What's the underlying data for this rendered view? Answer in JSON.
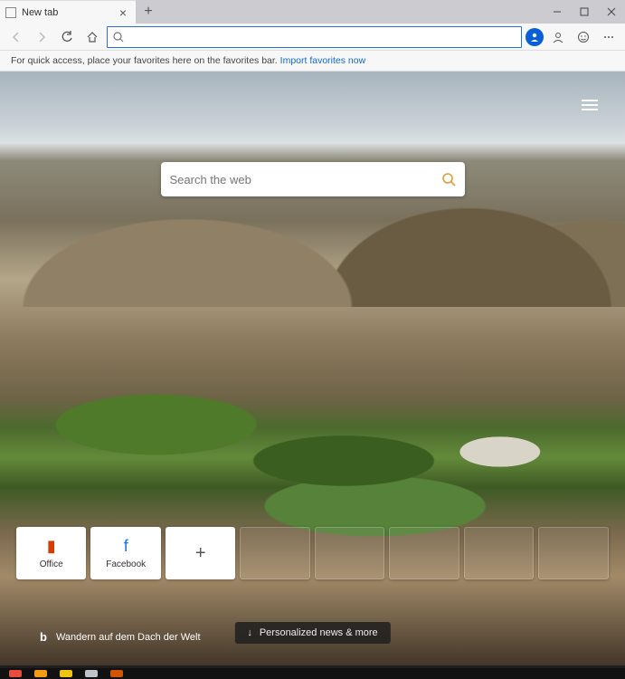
{
  "window": {
    "tab_title": "New tab"
  },
  "favorites_hint": {
    "text": "For quick access, place your favorites here on the favorites bar.",
    "link": "Import favorites now"
  },
  "address_bar": {
    "value": "",
    "placeholder": ""
  },
  "newtab": {
    "search_placeholder": "Search the web",
    "tiles": [
      {
        "label": "Office",
        "icon": "office"
      },
      {
        "label": "Facebook",
        "icon": "fb"
      }
    ],
    "caption": "Wandern auf dem Dach der Welt",
    "news_chip": "Personalized news & more"
  }
}
